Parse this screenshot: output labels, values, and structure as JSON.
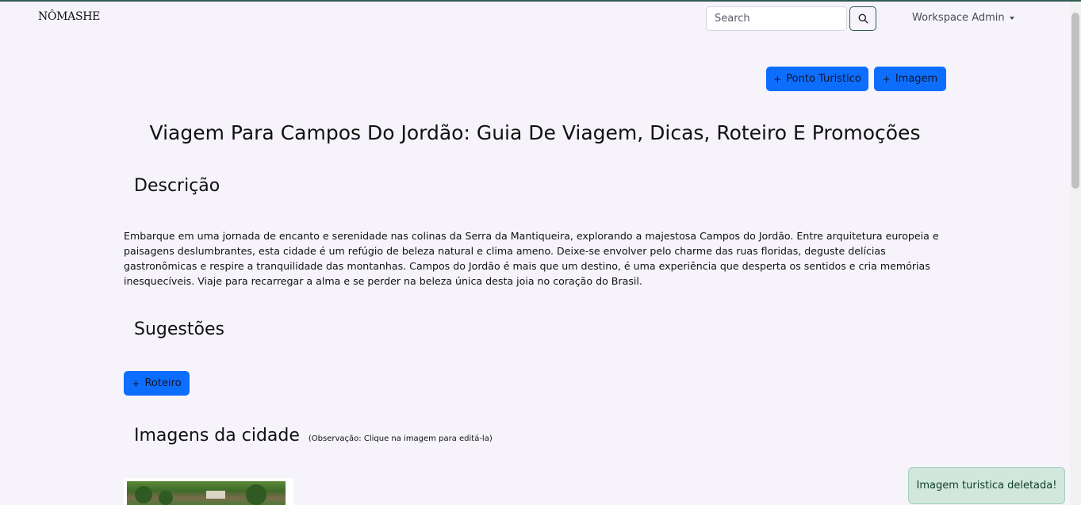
{
  "navbar": {
    "brand": "NÔMASHE",
    "search_placeholder": "Search",
    "search_icon": "search-icon",
    "user_menu": "Workspace Admin"
  },
  "actions": {
    "add_ponto": "Ponto Turistico",
    "add_imagem": "Imagem",
    "add_roteiro": "Roteiro"
  },
  "page": {
    "title": "Viagem Para Campos Do Jordão: Guia De Viagem, Dicas, Roteiro E Promoções",
    "description_heading": "Descrição",
    "description_text": "Embarque em uma jornada de encanto e serenidade nas colinas da Serra da Mantiqueira, explorando a majestosa Campos do Jordão. Entre arquitetura europeia e paisagens deslumbrantes, esta cidade é um refúgio de beleza natural e clima ameno. Deixe-se envolver pelo charme das ruas floridas, deguste delícias gastronômicas e respire a tranquilidade das montanhas. Campos do Jordão é mais que um destino, é uma experiência que desperta os sentidos e cria memórias inesquecíveis. Viaje para recarregar a alma e se perder na beleza única desta joia no coração do Brasil.",
    "suggestions_heading": "Sugestões",
    "images_heading": "Imagens da cidade",
    "images_note": "(Observação: Clique na imagem para editá-la)"
  },
  "toast": {
    "message": "Imagem turistica deletada!"
  }
}
